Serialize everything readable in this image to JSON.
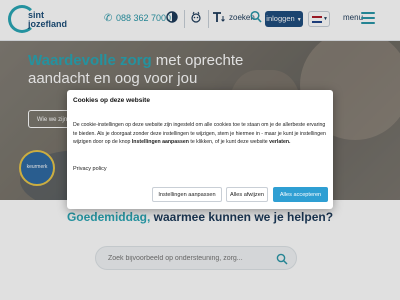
{
  "header": {
    "logo_line1": "sint",
    "logo_line2": "jozefland",
    "phone": "088 362 7000",
    "search_label": "zoeken",
    "login_label": "inloggen",
    "menu_label": "menu",
    "language_flag": [
      "#ae1c28",
      "#ffffff",
      "#21468b"
    ]
  },
  "hero": {
    "title_highlight": "Waardevolle zorg",
    "title_rest": " met oprechte aandacht en oog voor jou",
    "button_label": "Wie we zijn",
    "badge_text": "keurmerk"
  },
  "main": {
    "greeting_accent": "Goedemiddag,",
    "greeting_rest": " waarmee kunnen we je helpen?",
    "search_placeholder": "Zoek bijvoorbeeld op ondersteuning, zorg..."
  },
  "cookie_modal": {
    "title": "Cookies op deze website",
    "text_part1": "De cookie-instellingen op deze website zijn ingesteld om alle cookies toe te staan om je de allerbeste ervaring te bieden. Als je doorgaat zonder deze instellingen te wijzigen, stem je hiermee in - maar je kunt je instellingen wijzigen door op de knop ",
    "text_bold1": "Instellingen aanpassen",
    "text_part2": " te klikken, of je kunt deze website ",
    "text_bold2": "verlaten.",
    "privacy_link": "Privacy policy",
    "settings_button": "Instellingen aanpassen",
    "reject_button": "Alles afwijzen",
    "accept_button": "Alles accepteren"
  },
  "colors": {
    "accent_teal": "#2aa7b5",
    "navy": "#1f4e7f",
    "accept_blue": "#2f9fd3"
  }
}
